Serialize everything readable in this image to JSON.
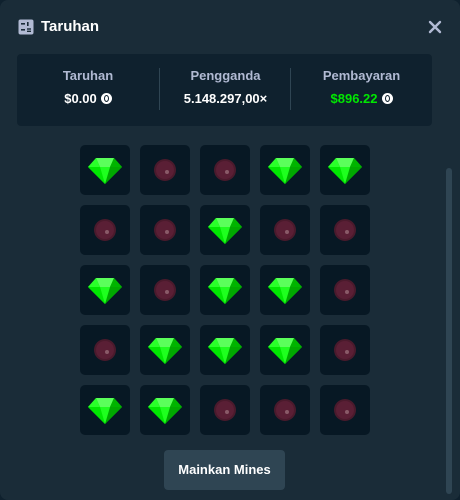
{
  "header": {
    "title": "Taruhan"
  },
  "stats": {
    "bet_label": "Taruhan",
    "bet_value": "$0.00",
    "multiplier_label": "Pengganda",
    "multiplier_value": "5.148.297,00×",
    "payout_label": "Pembayaran",
    "payout_value": "$896.22"
  },
  "board": {
    "rows": [
      [
        "gem",
        "mine",
        "mine",
        "gem",
        "gem"
      ],
      [
        "mine",
        "mine",
        "gem",
        "mine",
        "mine"
      ],
      [
        "gem",
        "mine",
        "gem",
        "gem",
        "mine"
      ],
      [
        "mine",
        "gem",
        "gem",
        "gem",
        "mine"
      ],
      [
        "gem",
        "gem",
        "mine",
        "mine",
        "mine"
      ]
    ]
  },
  "colors": {
    "gem": "#00e701",
    "mine": "#4a1a2c",
    "payout": "#00e701"
  },
  "actions": {
    "play_label": "Mainkan Mines"
  }
}
